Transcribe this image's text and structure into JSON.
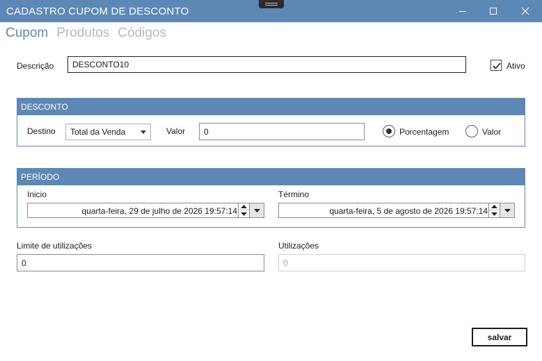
{
  "window": {
    "title": "CADASTRO CUPOM DE DESCONTO"
  },
  "tabs": [
    {
      "label": "Cupom",
      "active": true
    },
    {
      "label": "Produtos",
      "active": false
    },
    {
      "label": "Códigos",
      "active": false
    }
  ],
  "descricao": {
    "label": "Descrição",
    "value": "DESCONTO10"
  },
  "ativo": {
    "label": "Ativo",
    "checked": true
  },
  "desconto": {
    "header": "DESCONTO",
    "destino_label": "Destino",
    "destino_value": "Total da Venda",
    "valor_label": "Valor",
    "valor_value": "0",
    "radio_porcentagem": {
      "label": "Porcentagem",
      "checked": true
    },
    "radio_valor": {
      "label": "Valor",
      "checked": false
    }
  },
  "periodo": {
    "header": "PERÍODO",
    "inicio_label": "Inicio",
    "inicio_value": "quarta-feira, 29 de julho de 2026 19:57:14",
    "termino_label": "Término",
    "termino_value": "quarta-feira, 5 de agosto de 2026 19:57:14"
  },
  "limite": {
    "label": "Limite de utilizações",
    "value": "0"
  },
  "utilizacoes": {
    "label": "Utilizações",
    "value": "0"
  },
  "actions": {
    "save_label": "salvar"
  },
  "colors": {
    "accent": "#5d88b5",
    "tab_inactive": "#b9b9b9",
    "disabled_text": "#a0a0a0"
  },
  "icons": {
    "minimize": "minimize-icon",
    "maximize": "maximize-icon",
    "close": "close-icon",
    "checkmark": "checkmark-icon",
    "dropdown": "chevron-down-icon",
    "spin_up": "spin-up-icon",
    "spin_down": "spin-down-icon"
  }
}
